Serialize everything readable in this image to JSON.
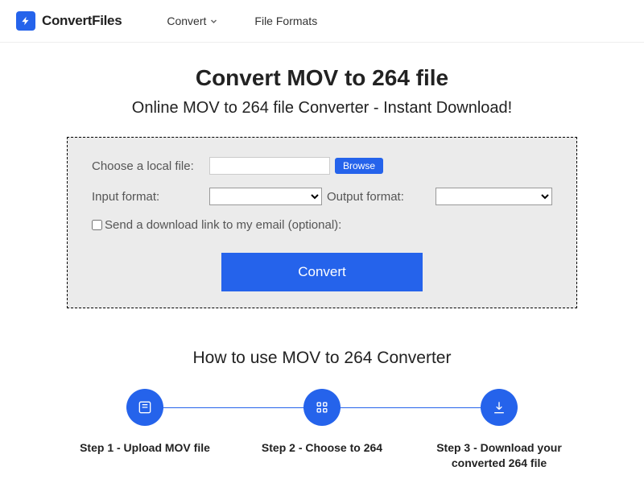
{
  "header": {
    "brand": "ConvertFiles",
    "nav": {
      "convert": "Convert",
      "formats": "File Formats"
    }
  },
  "hero": {
    "title": "Convert MOV to 264 file",
    "subtitle": "Online MOV to 264 file Converter - Instant Download!"
  },
  "form": {
    "choose_label": "Choose a local file:",
    "browse": "Browse",
    "input_format_label": "Input format:",
    "output_format_label": "Output format:",
    "email_label": "Send a download link to my email (optional):",
    "convert": "Convert"
  },
  "howto": {
    "title": "How to use MOV to 264 Converter",
    "steps": [
      "Step 1 - Upload MOV file",
      "Step 2 - Choose to 264",
      "Step 3 - Download your converted 264 file"
    ]
  }
}
